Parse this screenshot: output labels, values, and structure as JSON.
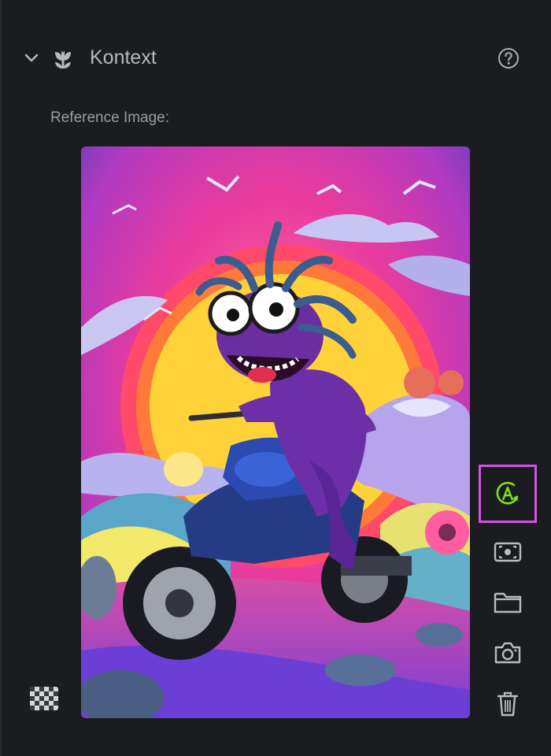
{
  "panel": {
    "title": "Kontext",
    "reference_label": "Reference Image:"
  },
  "icons": {
    "collapse": "chevron-down-icon",
    "section": "flower-icon",
    "help": "help-circle-icon",
    "transparency": "checkerboard-icon",
    "tools": [
      "auto-refresh-icon",
      "screen-capture-icon",
      "folder-icon",
      "camera-icon",
      "trash-icon"
    ]
  },
  "colors": {
    "background": "#1b1c1f",
    "accent_active": "#d44fe6",
    "auto_icon": "#7fe31a",
    "icon": "#b9babf"
  },
  "image": {
    "description_name": "reference-image"
  }
}
